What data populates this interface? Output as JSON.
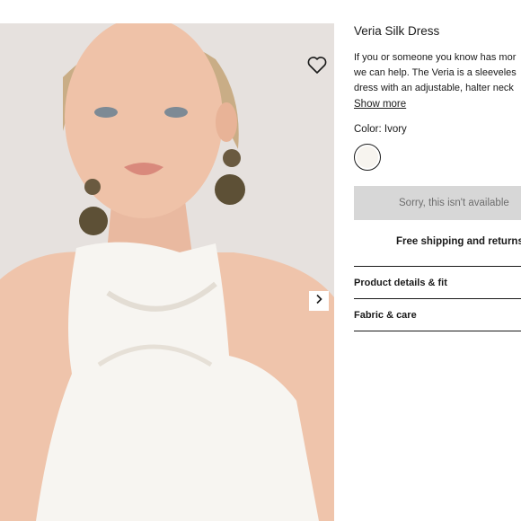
{
  "gallery": {
    "image_alt": "Model wearing Veria Silk Dress",
    "wishlist_icon": "heart-outline-icon",
    "next_icon": "chevron-right-icon"
  },
  "product": {
    "title": "Veria Silk Dress",
    "description_lines": [
      "If you or someone you know has mor",
      "we can help. The Veria is a sleeveles",
      "dress with an adjustable, halter neck"
    ],
    "show_more": "Show more",
    "color_label": "Color: Ivory",
    "swatch_color": "#f7f4ef",
    "unavailable": "Sorry, this isn't available",
    "shipping": "Free shipping and returns"
  },
  "accordion": [
    {
      "label": "Product details & fit"
    },
    {
      "label": "Fabric & care"
    }
  ],
  "colors": {
    "text": "#1a1a1a",
    "disabled_bg": "#d7d7d7",
    "disabled_text": "#6e6e6e",
    "photo_bg": "#e4dfdc"
  }
}
